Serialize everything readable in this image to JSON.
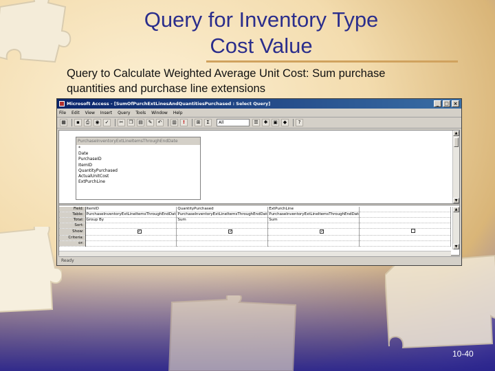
{
  "slide": {
    "title_line1": "Query for Inventory Type",
    "title_line2": "Cost Value",
    "subtitle": "Query to Calculate Weighted Average Unit Cost: Sum purchase quantities and purchase line extensions",
    "page_number": "10-40"
  },
  "window": {
    "title": "Microsoft Access - [SumOfPurchExtLinesAndQuantitiesPurchased : Select Query]",
    "menu": [
      "File",
      "Edit",
      "View",
      "Insert",
      "Query",
      "Tools",
      "Window",
      "Help"
    ],
    "toolbar_combo": "All",
    "status": "Ready"
  },
  "field_list": {
    "title": "PurchaseInventoryExtLineItemsThroughEndDate",
    "fields": [
      "*",
      "Date",
      "PurchaseID",
      "ItemID",
      "QuantityPurchased",
      "ActualUnitCost",
      "ExtPurchLine"
    ]
  },
  "design_grid": {
    "row_labels": [
      "Field:",
      "Table:",
      "Total:",
      "Sort:",
      "Show:",
      "Criteria:",
      "or:"
    ],
    "columns": [
      {
        "field": "ItemID",
        "table": "PurchaseInventoryExtLineItemsThroughEndDate",
        "total": "Group By",
        "sort": "",
        "show": true
      },
      {
        "field": "QuantityPurchased",
        "table": "PurchaseInventoryExtLineItemsThroughEndDate",
        "total": "Sum",
        "sort": "",
        "show": true
      },
      {
        "field": "ExtPurchLine",
        "table": "PurchaseInventoryExtLineItemsThroughEndDate",
        "total": "Sum",
        "sort": "",
        "show": true
      },
      {
        "field": "",
        "table": "",
        "total": "",
        "sort": "",
        "show": false
      }
    ]
  },
  "colors": {
    "title": "#2b2e8c",
    "rule": "#d0a25e",
    "window_titlebar": "#0a246a"
  }
}
